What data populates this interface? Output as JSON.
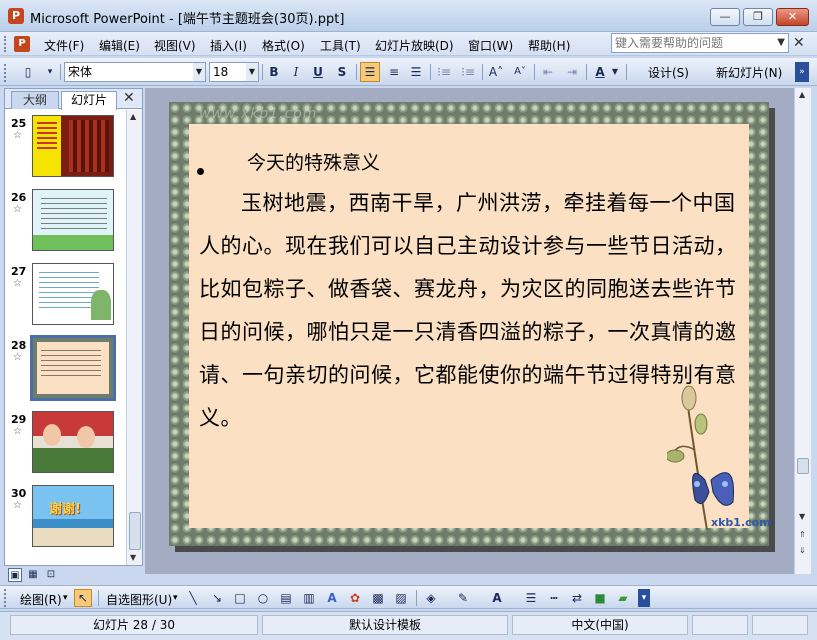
{
  "window": {
    "title": "Microsoft PowerPoint - [端午节主题班会(30页).ppt]",
    "app_icon_label": "P",
    "minimize_label": "—",
    "restore_label": "❐",
    "close_label": "✕"
  },
  "menu": {
    "items": [
      "文件(F)",
      "编辑(E)",
      "视图(V)",
      "插入(I)",
      "格式(O)",
      "工具(T)",
      "幻灯片放映(D)",
      "窗口(W)",
      "帮助(H)"
    ],
    "help_placeholder": "键入需要帮助的问题",
    "close_label": "✕"
  },
  "toolbar": {
    "font_name": "宋体",
    "font_size": "18",
    "bold": "B",
    "italic": "I",
    "underline": "U",
    "shadow": "S",
    "design_label": "设计(S)",
    "new_slide_label": "新幻灯片(N)",
    "active_align": "left",
    "font_color": "#1b2a8c"
  },
  "left_pane": {
    "tabs": [
      "大纲",
      "幻灯片"
    ],
    "active_tab": "幻灯片",
    "close_label": "✕",
    "slides": [
      {
        "number": "25"
      },
      {
        "number": "26"
      },
      {
        "number": "27"
      },
      {
        "number": "28",
        "selected": true
      },
      {
        "number": "29"
      },
      {
        "number": "30",
        "thumb_text": "谢谢!"
      }
    ]
  },
  "slide": {
    "watermark": "www.xkb1.com",
    "heading": "今天的特殊意义",
    "body": "玉树地震，西南干旱，广州洪涝，牵挂着每一个中国人的心。现在我们可以自己主动设计参与一些节日活动，比如包粽子、做香袋、赛龙舟，为灾区的同胞送去些许节日的问候，哪怕只是一只清香四溢的粽子，一次真情的邀请、一句亲切的问候，它都能使你的端午节过得特别有意义。",
    "logo_text": "xkb1.com"
  },
  "draw_toolbar": {
    "draw_label": "绘图(R)",
    "autoshapes_label": "自选图形(U)"
  },
  "status": {
    "slide_position": "幻灯片 28 / 30",
    "template": "默认设计模板",
    "language": "中文(中国)"
  }
}
